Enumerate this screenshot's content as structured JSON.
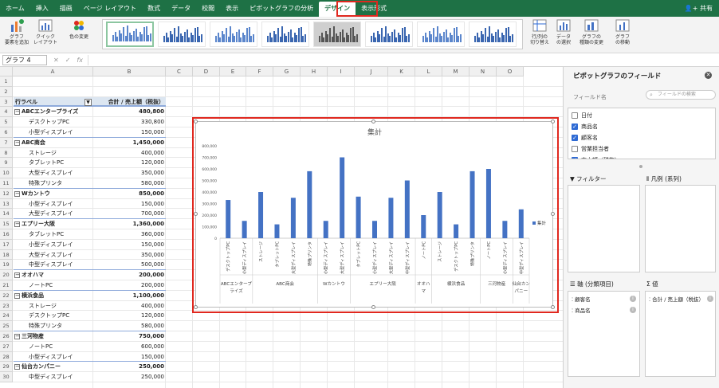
{
  "menu": {
    "tabs": [
      "ホーム",
      "挿入",
      "描画",
      "ページ レイアウト",
      "数式",
      "データ",
      "校閲",
      "表示",
      "ピボットグラフの分析",
      "デザイン",
      "表示形式"
    ],
    "share": "共有"
  },
  "ribbon": {
    "add_element": "グラフ\n要素を追加",
    "quick_layout": "クイック\nレイアウト",
    "change_color": "色の変更",
    "switch_rowcol": "行/列の\n切り替え",
    "select_data": "データ\nの選択",
    "change_type": "グラフの\n種類の変更",
    "move_chart": "グラフ\nの移動"
  },
  "formula": {
    "name_box": "グラフ 4",
    "fx": "fx"
  },
  "sheet": {
    "columns": [
      "A",
      "B",
      "C",
      "D",
      "E",
      "F",
      "G",
      "H",
      "I",
      "J",
      "K",
      "L",
      "M",
      "N",
      "O"
    ],
    "header": {
      "label": "行ラベル",
      "value": "合計 / 売上額（税抜）"
    },
    "rows": [
      {
        "n": "1",
        "a": "",
        "b": "",
        "t": "blank"
      },
      {
        "n": "2",
        "a": "",
        "b": "",
        "t": "blank"
      },
      {
        "n": "3",
        "a": "行ラベル",
        "b": "合計 / 売上額（税抜）",
        "t": "header"
      },
      {
        "n": "4",
        "a": "ABCエンタープライズ",
        "b": "480,800",
        "t": "group"
      },
      {
        "n": "5",
        "a": "デスクトップPC",
        "b": "330,800",
        "t": "item"
      },
      {
        "n": "6",
        "a": "小型ディスプレイ",
        "b": "150,000",
        "t": "item"
      },
      {
        "n": "7",
        "a": "ABC商会",
        "b": "1,450,000",
        "t": "group"
      },
      {
        "n": "8",
        "a": "ストレージ",
        "b": "400,000",
        "t": "item"
      },
      {
        "n": "9",
        "a": "タブレットPC",
        "b": "120,000",
        "t": "item"
      },
      {
        "n": "10",
        "a": "大型ディスプレイ",
        "b": "350,000",
        "t": "item"
      },
      {
        "n": "11",
        "a": "特殊プリンタ",
        "b": "580,000",
        "t": "item"
      },
      {
        "n": "12",
        "a": "Wカントウ",
        "b": "850,000",
        "t": "group"
      },
      {
        "n": "13",
        "a": "小型ディスプレイ",
        "b": "150,000",
        "t": "item"
      },
      {
        "n": "14",
        "a": "大型ディスプレイ",
        "b": "700,000",
        "t": "item"
      },
      {
        "n": "15",
        "a": "エプリー大阪",
        "b": "1,360,000",
        "t": "group"
      },
      {
        "n": "16",
        "a": "タブレットPC",
        "b": "360,000",
        "t": "item"
      },
      {
        "n": "17",
        "a": "小型ディスプレイ",
        "b": "150,000",
        "t": "item"
      },
      {
        "n": "18",
        "a": "大型ディスプレイ",
        "b": "350,000",
        "t": "item"
      },
      {
        "n": "19",
        "a": "中型ディスプレイ",
        "b": "500,000",
        "t": "item"
      },
      {
        "n": "20",
        "a": "オオハマ",
        "b": "200,000",
        "t": "group"
      },
      {
        "n": "21",
        "a": "ノートPC",
        "b": "200,000",
        "t": "item"
      },
      {
        "n": "22",
        "a": "横浜食品",
        "b": "1,100,000",
        "t": "group"
      },
      {
        "n": "23",
        "a": "ストレージ",
        "b": "400,000",
        "t": "item"
      },
      {
        "n": "24",
        "a": "デスクトップPC",
        "b": "120,000",
        "t": "item"
      },
      {
        "n": "25",
        "a": "特殊プリンタ",
        "b": "580,000",
        "t": "item"
      },
      {
        "n": "26",
        "a": "三河物産",
        "b": "750,000",
        "t": "group"
      },
      {
        "n": "27",
        "a": "ノートPC",
        "b": "600,000",
        "t": "item"
      },
      {
        "n": "28",
        "a": "小型ディスプレイ",
        "b": "150,000",
        "t": "item"
      },
      {
        "n": "29",
        "a": "仙台カンパニー",
        "b": "250,000",
        "t": "group"
      },
      {
        "n": "30",
        "a": "中型ディスプレイ",
        "b": "250,000",
        "t": "item"
      }
    ]
  },
  "chart_data": {
    "type": "bar",
    "title": "集計",
    "legend": "集計",
    "legend_position": "right",
    "ylim": [
      0,
      800000
    ],
    "yticks": [
      "0",
      "100,000",
      "200,000",
      "300,000",
      "400,000",
      "500,000",
      "600,000",
      "700,000",
      "800,000"
    ],
    "color": "#4472c4",
    "categories": [
      "デスクトップPC",
      "小型ディスプレイ",
      "ストレージ",
      "タブレットPC",
      "大型ディスプレイ",
      "特殊プリンタ",
      "小型ディスプレイ",
      "大型ディスプレイ",
      "タブレットPC",
      "小型ディスプレイ",
      "大型ディスプレイ",
      "中型ディスプレイ",
      "ノートPC",
      "ストレージ",
      "デスクトップPC",
      "特殊プリンタ",
      "ノートPC",
      "小型ディスプレイ",
      "中型ディスプレイ"
    ],
    "values": [
      330800,
      150000,
      400000,
      120000,
      350000,
      580000,
      150000,
      700000,
      360000,
      150000,
      350000,
      500000,
      200000,
      400000,
      120000,
      580000,
      600000,
      150000,
      250000
    ],
    "groups": [
      {
        "label": "ABCエンタープ\nライズ",
        "start": 0,
        "count": 2
      },
      {
        "label": "ABC商会",
        "start": 2,
        "count": 4
      },
      {
        "label": "Wカントウ",
        "start": 6,
        "count": 2
      },
      {
        "label": "エプリー大阪",
        "start": 8,
        "count": 4
      },
      {
        "label": "オオハ\nマ",
        "start": 12,
        "count": 1
      },
      {
        "label": "横浜食品",
        "start": 13,
        "count": 3
      },
      {
        "label": "三河物産",
        "start": 16,
        "count": 2
      },
      {
        "label": "仙台カン\nパニー",
        "start": 18,
        "count": 1
      }
    ]
  },
  "panel": {
    "title": "ピボットグラフのフィールド",
    "field_name_label": "フィールド名",
    "search_placeholder": "フィールドの検索",
    "fields": [
      {
        "name": "日付",
        "checked": false
      },
      {
        "name": "商品名",
        "checked": true
      },
      {
        "name": "顧客名",
        "checked": true
      },
      {
        "name": "営業担当者",
        "checked": false
      },
      {
        "name": "売上額（税抜）",
        "checked": true
      }
    ],
    "filter_label": "フィルター",
    "legend_label": "凡例 (系列)",
    "axis_label": "軸 (分類項目)",
    "values_label": "値",
    "axis_items": [
      "顧客名",
      "商品名"
    ],
    "value_items": [
      "合計 / 売上額（税抜）"
    ]
  }
}
